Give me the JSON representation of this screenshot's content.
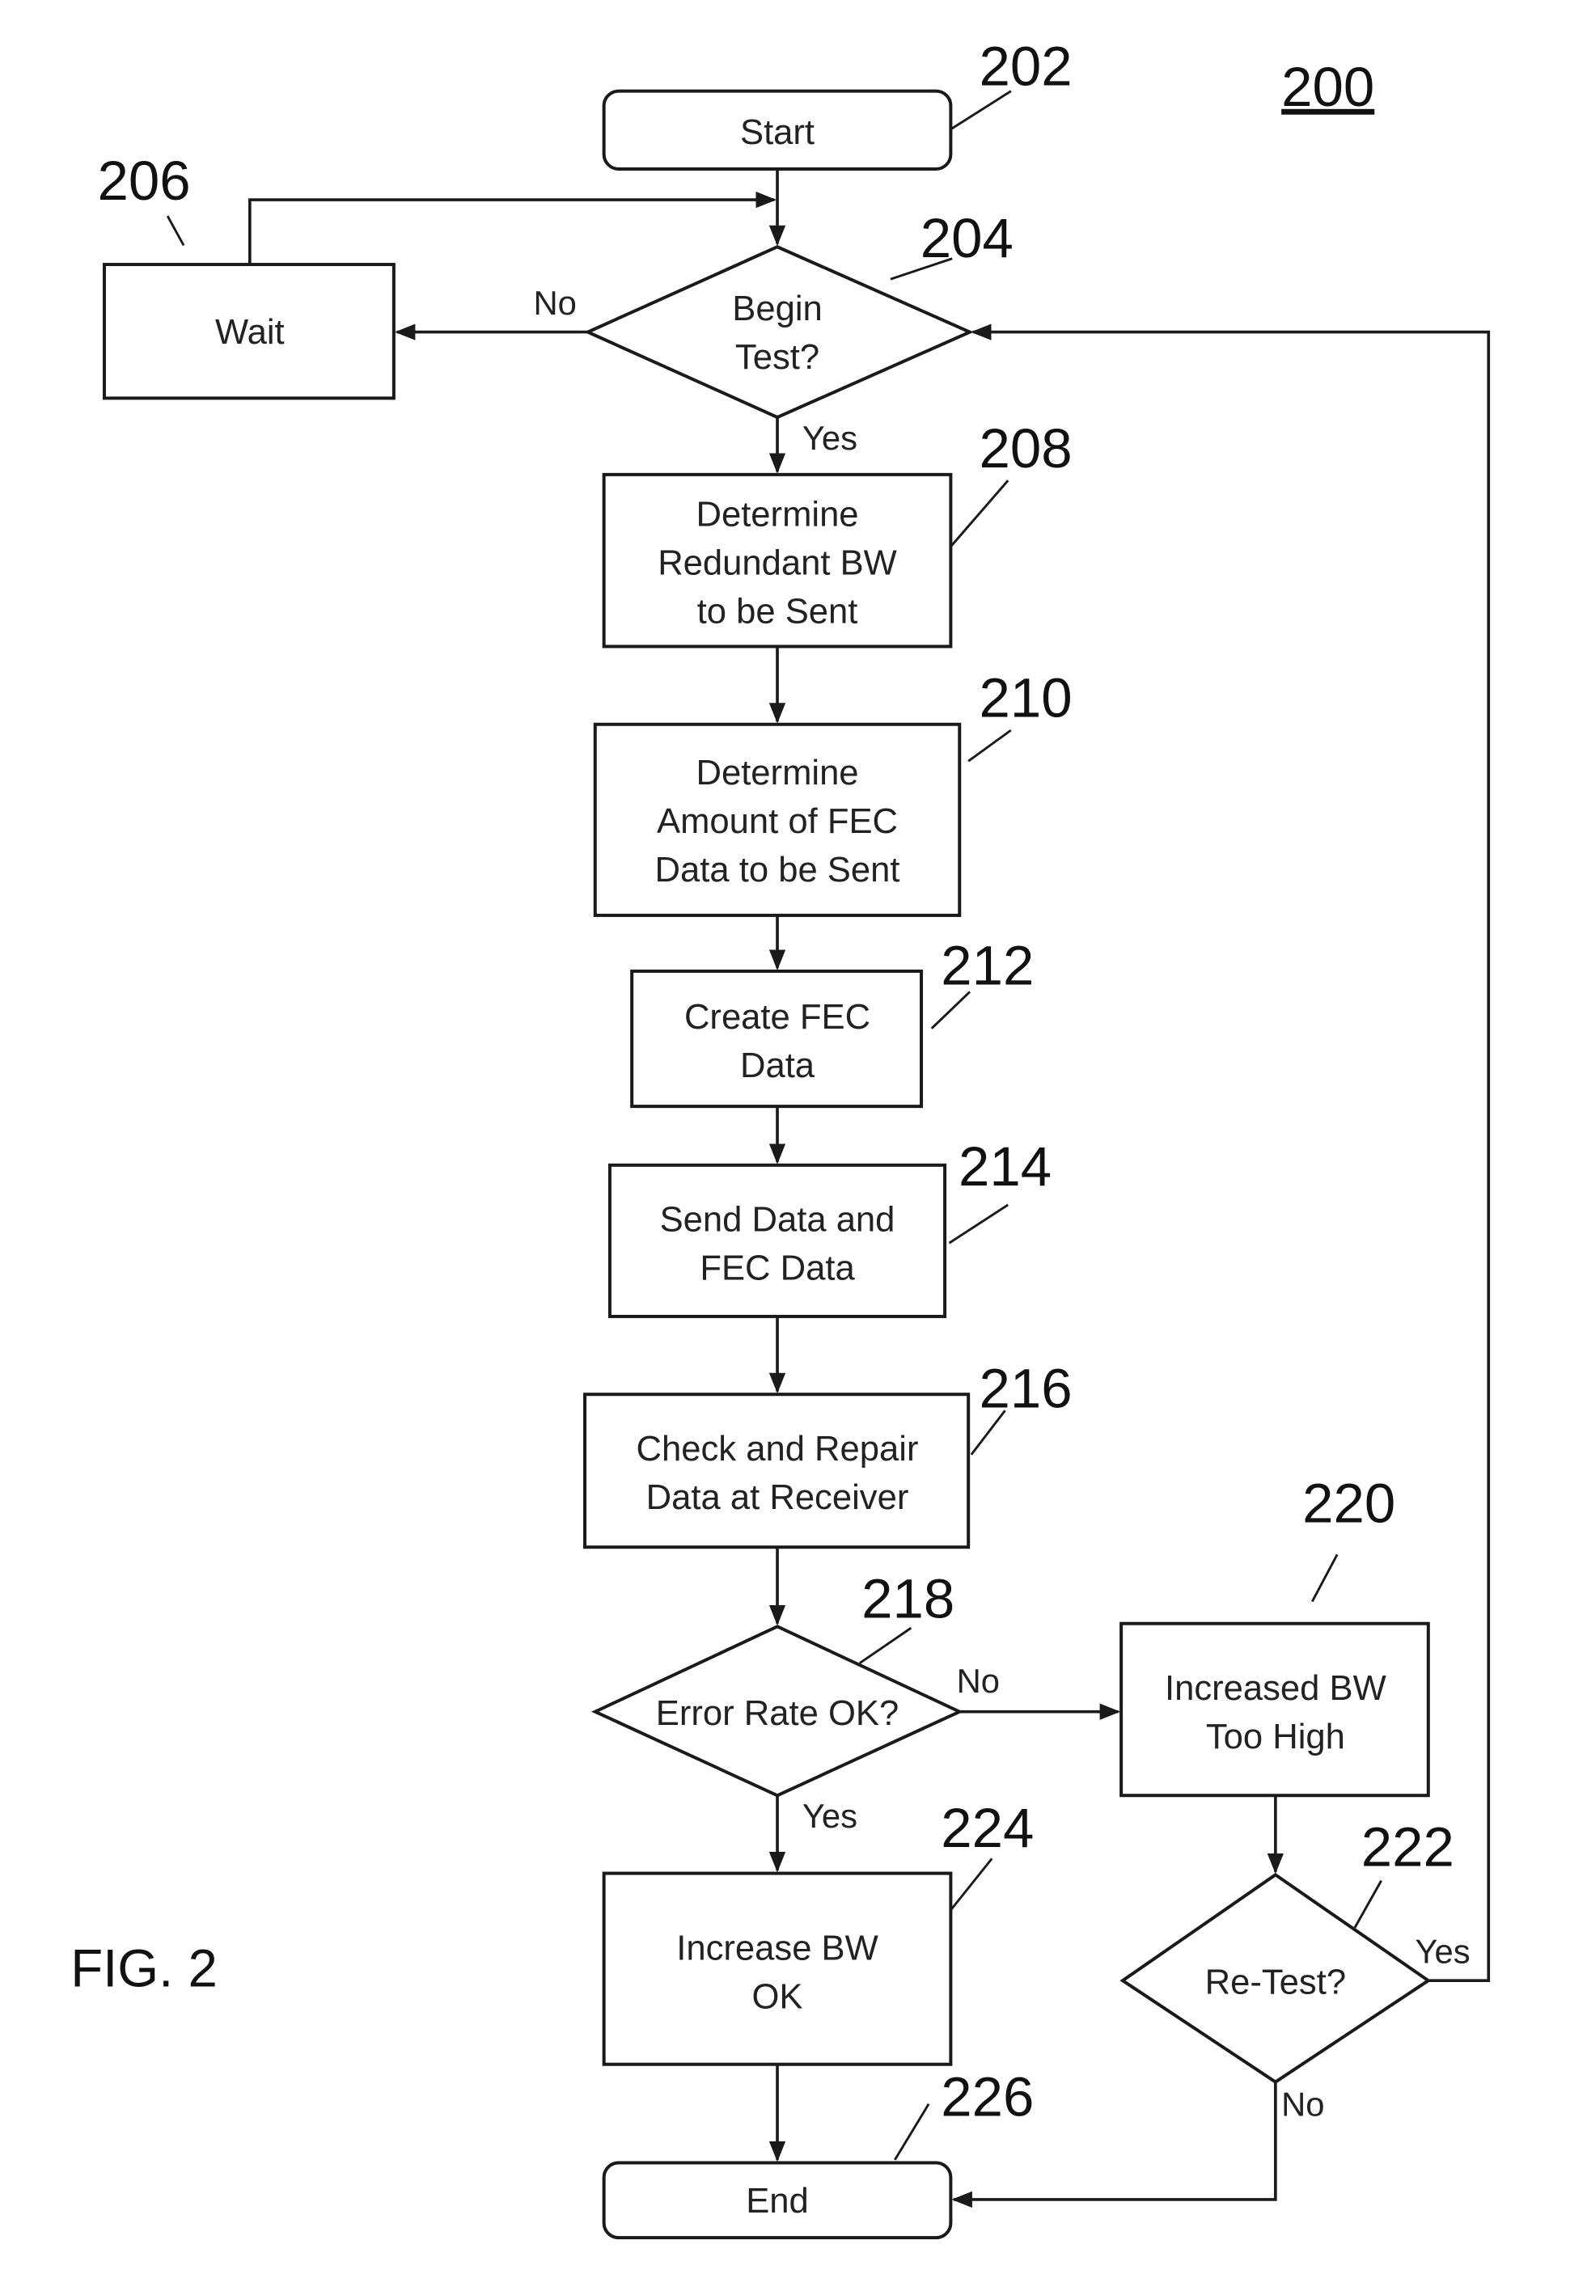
{
  "figure": {
    "label": "FIG. 2",
    "ref": "200"
  },
  "nodes": {
    "start": {
      "ref": "202",
      "lines": [
        "Start"
      ]
    },
    "begin_test": {
      "ref": "204",
      "lines": [
        "Begin",
        "Test?"
      ]
    },
    "wait": {
      "ref": "206",
      "lines": [
        "Wait"
      ]
    },
    "determine_bw": {
      "ref": "208",
      "lines": [
        "Determine",
        "Redundant BW",
        "to be Sent"
      ]
    },
    "determine_fec": {
      "ref": "210",
      "lines": [
        "Determine",
        "Amount of FEC",
        "Data to be Sent"
      ]
    },
    "create_fec": {
      "ref": "212",
      "lines": [
        "Create FEC",
        "Data"
      ]
    },
    "send_data": {
      "ref": "214",
      "lines": [
        "Send Data and",
        "FEC Data"
      ]
    },
    "check_repair": {
      "ref": "216",
      "lines": [
        "Check and Repair",
        "Data at Receiver"
      ]
    },
    "error_rate": {
      "ref": "218",
      "lines": [
        "Error Rate OK?"
      ]
    },
    "bw_too_high": {
      "ref": "220",
      "lines": [
        "Increased BW",
        "Too High"
      ]
    },
    "retest": {
      "ref": "222",
      "lines": [
        "Re-Test?"
      ]
    },
    "bw_ok": {
      "ref": "224",
      "lines": [
        "Increase BW",
        "OK"
      ]
    },
    "end": {
      "ref": "226",
      "lines": [
        "End"
      ]
    }
  },
  "edge_labels": {
    "begin_no": "No",
    "begin_yes": "Yes",
    "error_no": "No",
    "error_yes": "Yes",
    "retest_yes": "Yes",
    "retest_no": "No"
  },
  "colors": {
    "ink": "#1a1a1a",
    "background": "#ffffff"
  }
}
